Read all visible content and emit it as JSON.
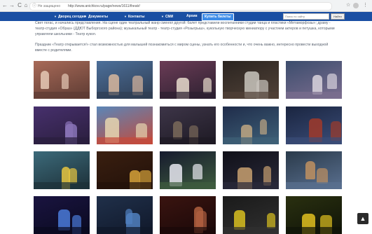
{
  "browser": {
    "back": "←",
    "forward": "→",
    "reload": "C",
    "home": "⌂",
    "security": "Не защищено",
    "url": "http://www.anichkov.ru/page/news/1611/theatr/",
    "star": "☆",
    "menu": "⋮"
  },
  "nav": {
    "items": [
      "Дворец сегодня",
      "Документы",
      "Контакты",
      "СМИ",
      "Архив"
    ],
    "tickets": "Купить билеты",
    "search_placeholder": "Поиск по сайту",
    "search_button": "Найти"
  },
  "content": {
    "para1": "Свет погас, и начались представления. На сцене один театральный жанр сменял другой: балет представили воспитанники студии танца и пластики «Метаморфозы»; драму - театр-студия «Образ» (ДДЮТ Выборгского района); музыкальный театр - театр-студия «Розыгрыш», кукольную творческую миниатюру с участием актеров и петушка, которыми управляли школьники - Театр кукол.",
    "para2": "Праздник «Театр открывается!» стал возможностью для малышей познакомиться с миром сцены, узнать его особенности и, что очень важно, интересно провести выходной вместе с родителями."
  },
  "gallery": {
    "photos": [
      {
        "c1": "#a86a58",
        "c2": "#e6c9b6",
        "c3": "#5d3b33"
      },
      {
        "c1": "#4c6f9a",
        "c2": "#d8b79e",
        "c3": "#2f3d52"
      },
      {
        "c1": "#6b3c56",
        "c2": "#e8dccc",
        "c3": "#2c2030"
      },
      {
        "c1": "#2a2420",
        "c2": "#c9c5bd",
        "c3": "#514238"
      },
      {
        "c1": "#3c4d6d",
        "c2": "#d9d3dd",
        "c3": "#7b6d8f"
      },
      {
        "c1": "#47306d",
        "c2": "#8a74b8",
        "c3": "#2a1e3d"
      },
      {
        "c1": "#5a86b8",
        "c2": "#e6d6b0",
        "c3": "#c44a3a"
      },
      {
        "c1": "#3d3548",
        "c2": "#7a6a5a",
        "c3": "#1e1a24"
      },
      {
        "c1": "#1f2c4a",
        "c2": "#bfa783",
        "c3": "#3f6178"
      },
      {
        "c1": "#1a2540",
        "c2": "#a03a2a",
        "c3": "#3b4d78"
      },
      {
        "c1": "#3c6a7a",
        "c2": "#e8c640",
        "c3": "#1d3038"
      },
      {
        "c1": "#3a1f10",
        "c2": "#d6a23a",
        "c3": "#22110a"
      },
      {
        "c1": "#161a2e",
        "c2": "#e8e8f0",
        "c3": "#3e5c3e"
      },
      {
        "c1": "#101018",
        "c2": "#c8a070",
        "c3": "#2a2a3a"
      },
      {
        "c1": "#2a3a4a",
        "c2": "#c09060",
        "c3": "#5a7090"
      },
      {
        "c1": "#1a1440",
        "c2": "#4a7ad8",
        "c3": "#0a0a20"
      },
      {
        "c1": "#20304a",
        "c2": "#5080c0",
        "c3": "#10182a"
      },
      {
        "c1": "#3a1410",
        "c2": "#b06040",
        "c3": "#1a0808"
      },
      {
        "c1": "#1a1a1a",
        "c2": "#d8c020",
        "c3": "#303030"
      },
      {
        "c1": "#2a3010",
        "c2": "#e0c020",
        "c3": "#101408"
      }
    ]
  }
}
